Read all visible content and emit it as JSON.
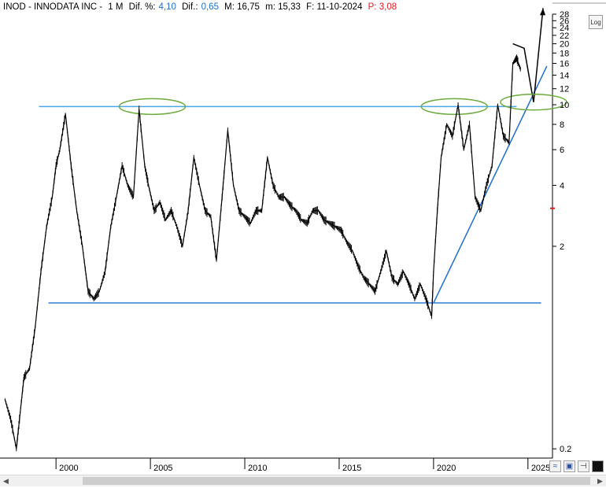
{
  "header": {
    "symbol": "INOD - INNODATA INC -",
    "period": "1 M",
    "dif_pct_label": "Dif. %:",
    "dif_pct_value": "4,10",
    "dif_label": "Dif.:",
    "dif_value": "0,65",
    "max_label": "M: 16,75",
    "min_label": "m: 15,33",
    "date_label": "F: 11-10-2024",
    "price_label": "P: 3,08"
  },
  "toolbar": {
    "log_label": "Log"
  },
  "colors": {
    "price": "#000000",
    "hline": "#2f7fd8",
    "hline_top": "#4aa8e8",
    "trendline": "#1f6fd1",
    "ellipse": "#6cab3c",
    "axis": "#000000",
    "price_marker": "#e01b1b"
  },
  "chart_data": {
    "type": "line",
    "scale": "log",
    "ylim": [
      0.18,
      28
    ],
    "xlim": [
      1997.2,
      2026.3
    ],
    "y_ticks": [
      28,
      26,
      24,
      22,
      20,
      18,
      16,
      14,
      12,
      10,
      8,
      6,
      4,
      2,
      0.2
    ],
    "y_tick_labels": [
      "28",
      "26",
      "24",
      "22",
      "20",
      "18",
      "16",
      "14",
      "12",
      "10",
      "8",
      "6",
      "4",
      "2",
      "0.2"
    ],
    "x_ticks": [
      2000,
      2005,
      2010,
      2015,
      2020,
      2025
    ],
    "x_tick_labels": [
      "2000",
      "2005",
      "2010",
      "2015",
      "2020",
      "2025"
    ],
    "series": [
      {
        "x": [
          1997.3,
          1997.6,
          1997.9,
          1998.1,
          1998.3,
          1998.6,
          1998.9,
          1999.2,
          1999.5,
          1999.8,
          2000.0,
          2000.2,
          2000.5,
          2000.8,
          2001.1,
          2001.4,
          2001.7,
          2002.0,
          2002.3,
          2002.6,
          2002.9,
          2003.2,
          2003.5,
          2003.8,
          2004.1,
          2004.4,
          2004.7,
          2004.9,
          2005.2,
          2005.5,
          2005.8,
          2006.1,
          2006.4,
          2006.7,
          2007.0,
          2007.3,
          2007.6,
          2007.9,
          2008.2,
          2008.5,
          2008.8,
          2009.1,
          2009.4,
          2009.7,
          2010.0,
          2010.3,
          2010.6,
          2010.9,
          2011.2,
          2011.5,
          2011.8,
          2012.1,
          2012.4,
          2012.7,
          2013.0,
          2013.3,
          2013.6,
          2013.9,
          2014.2,
          2014.5,
          2014.8,
          2015.1,
          2015.4,
          2015.7,
          2016.0,
          2016.3,
          2016.6,
          2016.9,
          2017.2,
          2017.5,
          2017.8,
          2018.1,
          2018.4,
          2018.7,
          2019.0,
          2019.3,
          2019.6,
          2019.9,
          2020.0,
          2020.2,
          2020.4,
          2020.7,
          2021.0,
          2021.3,
          2021.6,
          2021.9,
          2022.2,
          2022.5,
          2022.8,
          2023.1,
          2023.4,
          2023.7,
          2024.0,
          2024.2,
          2024.4,
          2024.6
        ],
        "y": [
          0.35,
          0.28,
          0.2,
          0.3,
          0.45,
          0.5,
          0.8,
          1.5,
          2.5,
          3.5,
          5,
          6,
          9,
          5,
          3,
          2,
          1.2,
          1.1,
          1.2,
          1.5,
          2.5,
          3.5,
          5,
          4,
          3.5,
          9.5,
          5,
          4,
          3,
          3.3,
          2.7,
          3,
          2.5,
          2,
          3,
          5.5,
          4,
          3,
          2.8,
          1.7,
          3.5,
          7.5,
          4,
          3,
          2.8,
          2.6,
          3,
          3,
          5.5,
          4,
          3.5,
          3.5,
          3.2,
          3,
          2.7,
          2.6,
          3,
          3,
          2.7,
          2.6,
          2.5,
          2.4,
          2.1,
          1.9,
          1.6,
          1.4,
          1.3,
          1.2,
          1.5,
          1.9,
          1.4,
          1.3,
          1.5,
          1.3,
          1.1,
          1.3,
          1.1,
          0.9,
          1.5,
          3,
          5.5,
          8,
          7,
          10,
          6,
          8,
          3.5,
          3,
          4,
          5,
          10,
          7,
          6.5,
          16,
          17,
          15
        ]
      }
    ],
    "annotations": [
      {
        "type": "hline",
        "y": 9.8,
        "x0": 1999.1,
        "x1": 2024.4
      },
      {
        "type": "hline",
        "y": 1.05,
        "x0": 1999.6,
        "x1": 2025.7
      },
      {
        "type": "trendline",
        "x0": 2020.0,
        "y0": 1.05,
        "x1": 2026.0,
        "y1": 15.5
      },
      {
        "type": "projection",
        "x": [
          2024.2,
          2024.8,
          2025.3,
          2025.8
        ],
        "y": [
          20,
          19,
          10.3,
          30
        ]
      },
      {
        "type": "ellipse",
        "cx": 2005.1,
        "cy": 9.8
      },
      {
        "type": "ellipse",
        "cx": 2021.1,
        "cy": 9.8
      },
      {
        "type": "ellipse",
        "cx": 2025.3,
        "cy": 10.3
      }
    ]
  }
}
